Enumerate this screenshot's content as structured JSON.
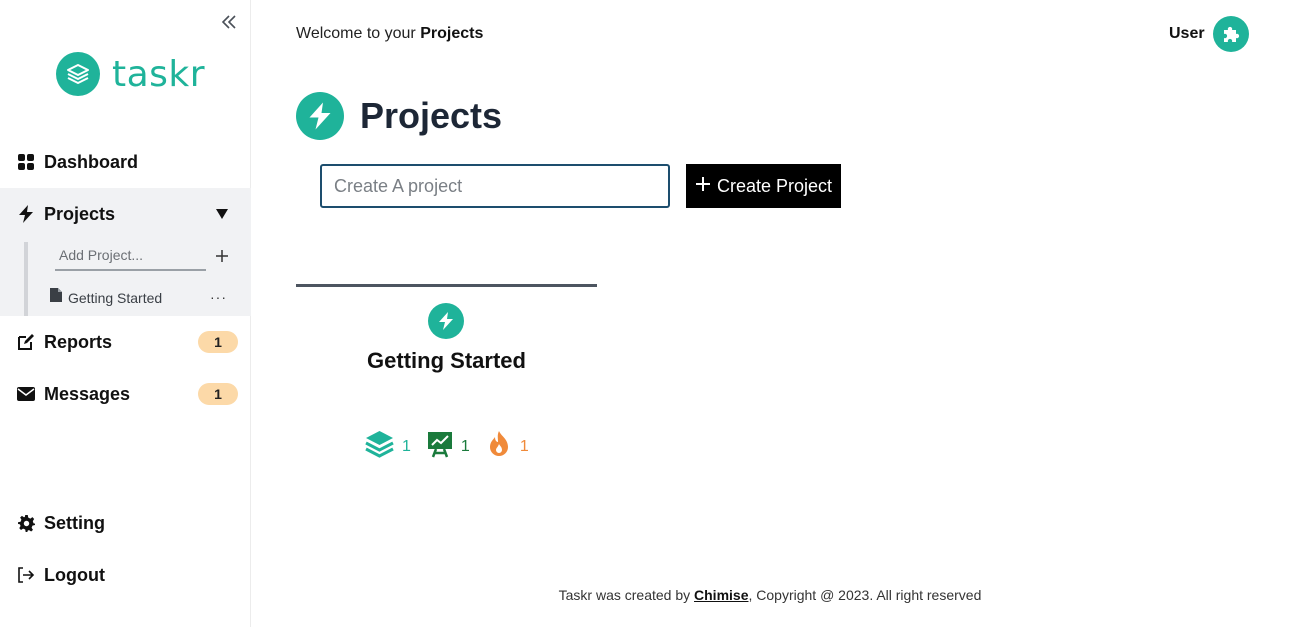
{
  "app": {
    "name": "taskr"
  },
  "sidebar": {
    "items": [
      {
        "label": "Dashboard"
      },
      {
        "label": "Projects"
      },
      {
        "label": "Reports",
        "badge": "1"
      },
      {
        "label": "Messages",
        "badge": "1"
      },
      {
        "label": "Setting"
      },
      {
        "label": "Logout"
      }
    ],
    "add_project_placeholder": "Add Project...",
    "sub_items": [
      {
        "label": "Getting Started"
      }
    ]
  },
  "header": {
    "welcome_prefix": "Welcome to your ",
    "welcome_strong": "Projects",
    "user_name": "User"
  },
  "main": {
    "title": "Projects",
    "input_placeholder": "Create A project",
    "create_button": "Create Project",
    "cards": [
      {
        "title": "Getting Started",
        "stats": [
          "1",
          "1",
          "1"
        ]
      }
    ]
  },
  "footer": {
    "prefix": "Taskr was created by ",
    "link": "Chimise",
    "suffix": ", Copyright @ 2023. All right reserved"
  },
  "colors": {
    "accent": "#1fb39a",
    "green": "#1a7a3c",
    "orange": "#f08a3a",
    "badge": "#fcd9a8"
  }
}
